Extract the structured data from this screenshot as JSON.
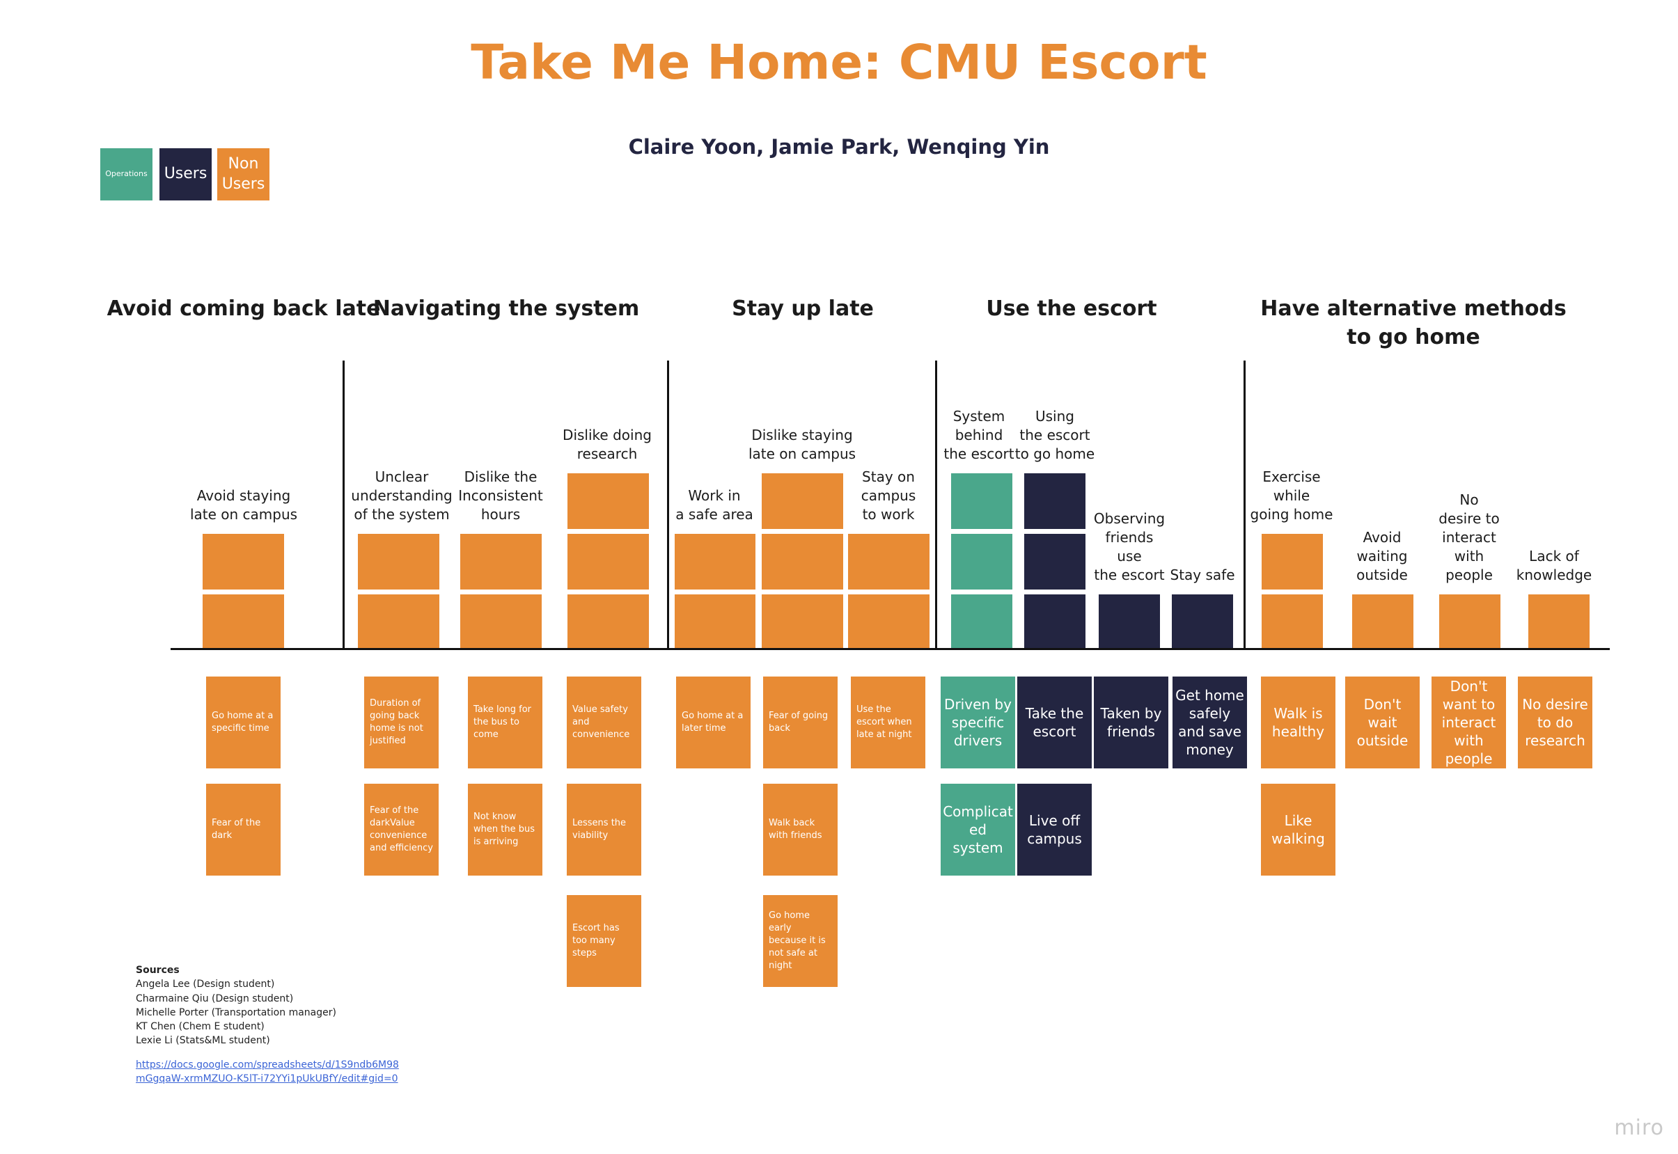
{
  "title": "Take Me Home: CMU Escort",
  "authors": "Claire Yoon, Jamie Park, Wenqing Yin",
  "colors": {
    "operations": "#4aa78b",
    "users": "#232541",
    "non_users": "#e88b34"
  },
  "legend": [
    {
      "label": "Operations",
      "type": "operations"
    },
    {
      "label": "Users",
      "type": "users"
    },
    {
      "label": "Non\nUsers",
      "type": "non_users"
    }
  ],
  "categories": [
    "Avoid coming back late",
    "Navigating the system",
    "Stay up late",
    "Use the escort",
    "Have alternative methods\nto go home"
  ],
  "subcategories": [
    "Avoid staying\nlate on campus",
    "Unclear\nunderstanding\nof the system",
    "Dislike the\nInconsistent\nhours",
    "Dislike doing\nresearch",
    "Work in\na safe area",
    "Dislike staying\nlate on campus",
    "Stay on\ncampus\nto work",
    "System\nbehind\nthe escort",
    "Using\nthe escort\nto go home",
    "Observing\nfriends\nuse\nthe escort",
    "Stay safe",
    "Exercise\nwhile\ngoing home",
    "Avoid\nwaiting\noutside",
    "No\ndesire to\ninteract\nwith\npeople",
    "Lack of\nknowledge"
  ],
  "stack_types": [
    "non_users",
    "non_users",
    "non_users",
    "non_users",
    "non_users",
    "non_users",
    "non_users",
    "operations",
    "users",
    "users",
    "users",
    "non_users",
    "non_users",
    "non_users",
    "non_users"
  ],
  "stack_counts": [
    2,
    2,
    2,
    3,
    2,
    3,
    2,
    3,
    3,
    1,
    1,
    2,
    1,
    1,
    1
  ],
  "cards": [
    {
      "text": "Go home at a specific time",
      "type": "non_users"
    },
    {
      "text": "Fear of the dark",
      "type": "non_users"
    },
    {
      "text": "Duration of going back home is not justified",
      "type": "non_users"
    },
    {
      "text": "Fear of the darkValue convenience and efficiency",
      "type": "non_users"
    },
    {
      "text": "Take long for the bus to come",
      "type": "non_users"
    },
    {
      "text": "Not know when the bus is arriving",
      "type": "non_users"
    },
    {
      "text": "Value safety and convenience",
      "type": "non_users"
    },
    {
      "text": "Lessens the viability",
      "type": "non_users"
    },
    {
      "text": "Escort has too many steps",
      "type": "non_users"
    },
    {
      "text": "Go home at a later time",
      "type": "non_users"
    },
    {
      "text": "Fear of going back",
      "type": "non_users"
    },
    {
      "text": "Walk back with friends",
      "type": "non_users"
    },
    {
      "text": "Go home early because it is not safe at night",
      "type": "non_users"
    },
    {
      "text": "Use the escort when late at night",
      "type": "non_users"
    },
    {
      "text": "Driven by specific drivers",
      "type": "operations"
    },
    {
      "text": "Complicat ed system",
      "type": "operations"
    },
    {
      "text": "Take the escort",
      "type": "users"
    },
    {
      "text": "Live off campus",
      "type": "users"
    },
    {
      "text": "Taken by friends",
      "type": "users"
    },
    {
      "text": "Get home safely and save money",
      "type": "users"
    },
    {
      "text": "Walk is healthy",
      "type": "non_users"
    },
    {
      "text": "Like walking",
      "type": "non_users"
    },
    {
      "text": "Don't wait outside",
      "type": "non_users"
    },
    {
      "text": "Don't want to interact with people",
      "type": "non_users"
    },
    {
      "text": "No desire to do research",
      "type": "non_users"
    }
  ],
  "sources": {
    "heading": "Sources",
    "items": [
      "Angela Lee (Design student)",
      "Charmaine Qiu (Design student)",
      "Michelle Porter (Transportation manager)",
      "KT Chen (Chem E student)",
      "Lexie Li (Stats&ML student)"
    ],
    "link": "https://docs.google.com/spreadsheets/d/1S9ndb6M98mGgqaW-xrmMZUO-K5lT-i72YYi1pUkUBfY/edit#gid=0"
  },
  "watermark": "miro"
}
